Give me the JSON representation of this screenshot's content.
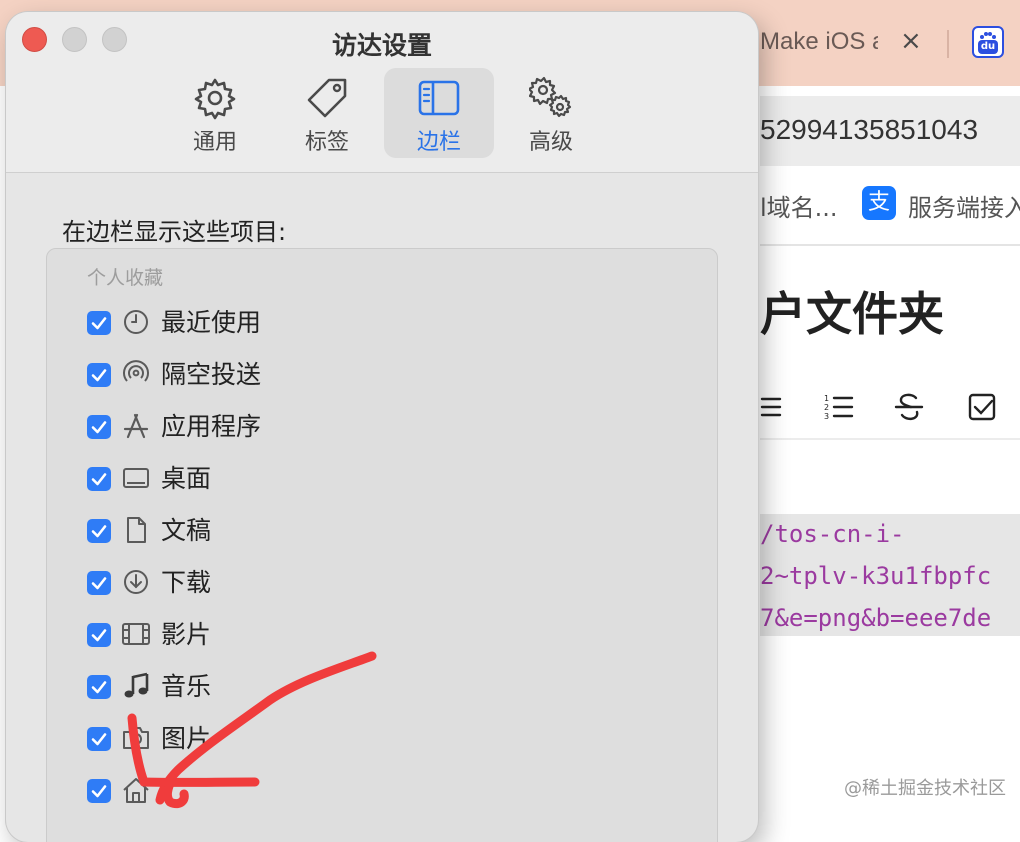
{
  "background_browser": {
    "tab_title": "Make iOS a",
    "tab_close": "×",
    "baidu_icon_text": "du",
    "url_text": "52994135851043",
    "bookmarks": [
      "l域名...",
      "服务端接入"
    ],
    "alipay_icon_text": "支",
    "page_heading": "户文件夹",
    "code_lines": [
      "/tos-cn-i-",
      "2~tplv-k3u1fbpfc",
      "7&e=png&b=eee7de"
    ],
    "watermark": "@稀土掘金技术社区"
  },
  "finder_settings": {
    "window_title": "访达设置",
    "tabs": [
      {
        "label": "通用",
        "icon": "gear-icon",
        "selected": false
      },
      {
        "label": "标签",
        "icon": "tag-icon",
        "selected": false
      },
      {
        "label": "边栏",
        "icon": "sidebar-icon",
        "selected": true
      },
      {
        "label": "高级",
        "icon": "gears-icon",
        "selected": false
      }
    ],
    "section_heading": "在边栏显示这些项目:",
    "group_header": "个人收藏",
    "items": [
      {
        "label": "最近使用",
        "icon": "clock-icon",
        "checked": true
      },
      {
        "label": "隔空投送",
        "icon": "airdrop-icon",
        "checked": true
      },
      {
        "label": "应用程序",
        "icon": "applications-icon",
        "checked": true
      },
      {
        "label": "桌面",
        "icon": "desktop-icon",
        "checked": true
      },
      {
        "label": "文稿",
        "icon": "document-icon",
        "checked": true
      },
      {
        "label": "下载",
        "icon": "download-icon",
        "checked": true
      },
      {
        "label": "影片",
        "icon": "film-icon",
        "checked": true
      },
      {
        "label": "音乐",
        "icon": "music-icon",
        "checked": true
      },
      {
        "label": "图片",
        "icon": "camera-icon",
        "checked": true
      },
      {
        "label": "",
        "icon": "home-icon",
        "checked": true
      }
    ]
  },
  "colors": {
    "accent_blue": "#2f7cf6",
    "selected_tab_text": "#2a73e8",
    "close_button_red": "#ee5a52",
    "annotation_red": "#f03c3c"
  }
}
